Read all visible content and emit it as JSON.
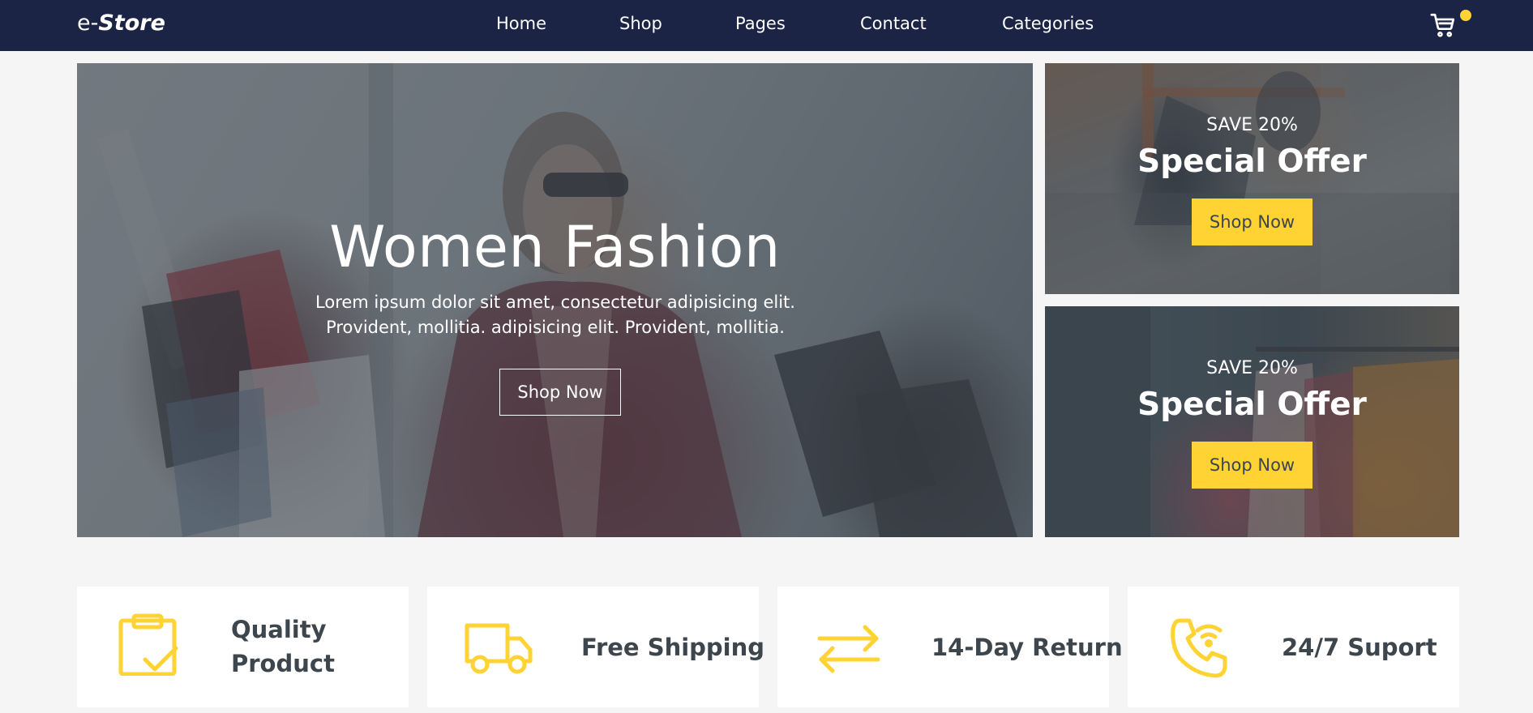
{
  "brand": {
    "prefix": "e-",
    "name": "Store"
  },
  "nav": {
    "items": [
      "Home",
      "Shop",
      "Pages",
      "Contact",
      "Categories"
    ],
    "cart_icon": "cart-icon"
  },
  "hero": {
    "title": "Women Fashion",
    "text": "Lorem ipsum dolor sit amet, consectetur adipisicing elit. Provident, mollitia. adipisicing elit. Provident, mollitia.",
    "button": "Shop Now"
  },
  "offers": [
    {
      "save": "SAVE 20%",
      "title": "Special Offer",
      "button": "Shop Now"
    },
    {
      "save": "SAVE 20%",
      "title": "Special Offer",
      "button": "Shop Now"
    }
  ],
  "features": [
    {
      "icon": "clipboard-check-icon",
      "label": "Quality Product"
    },
    {
      "icon": "truck-icon",
      "label": "Free Shipping"
    },
    {
      "icon": "exchange-arrows-icon",
      "label": "14-Day Return"
    },
    {
      "icon": "phone-wifi-icon",
      "label": "24/7 Suport"
    }
  ],
  "colors": {
    "navbar": "#1b2444",
    "accent": "#ffd333",
    "text": "#3d464d",
    "background": "#f5f5f5"
  }
}
